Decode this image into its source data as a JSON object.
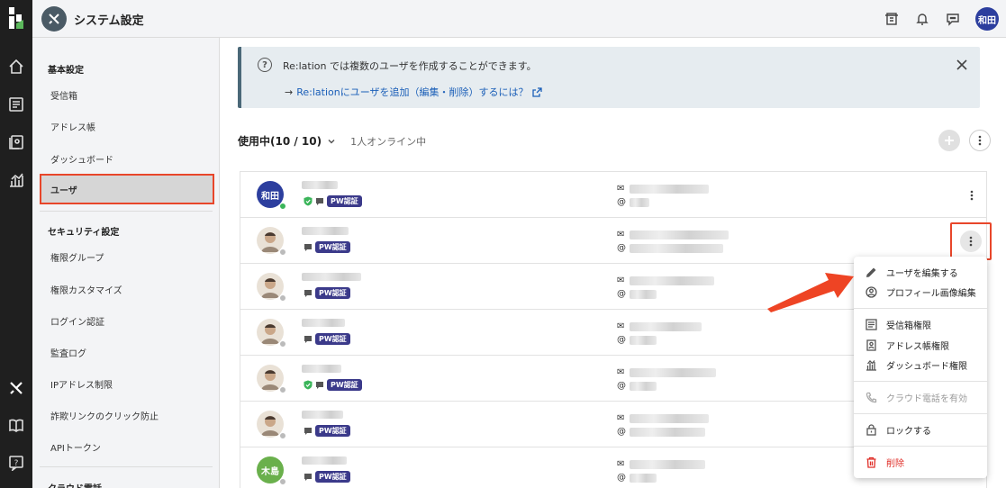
{
  "colors": {
    "accent": "#e8462a",
    "rail": "#1f1f1f",
    "link": "#1b5fb8",
    "pw_badge": "#3b3a8a",
    "danger": "#e0302a"
  },
  "header": {
    "title": "システム設定",
    "user_initials": "和田"
  },
  "sidebar": {
    "sections": [
      {
        "heading": "基本設定",
        "items": [
          "受信箱",
          "アドレス帳",
          "ダッシュボード",
          "ユーザ"
        ]
      },
      {
        "heading": "セキュリティ設定",
        "items": [
          "権限グループ",
          "権限カスタマイズ",
          "ログイン認証",
          "監査ログ",
          "IPアドレス制限",
          "詐欺リンクのクリック防止",
          "APIトークン"
        ]
      },
      {
        "heading": "クラウド電話",
        "items": []
      }
    ],
    "active_item": "ユーザ"
  },
  "banner": {
    "message": "Re:lation では複数のユーザを作成することができます。",
    "link_arrow": "→",
    "link_text": "Re:lationにユーザを追加（編集・削除）するには？"
  },
  "usage": {
    "label": "使用中(10 / 10)",
    "online": "1人オンライン中"
  },
  "users": [
    {
      "avatar_text": "和田",
      "avatar_color": "#2c3e9e",
      "online": true,
      "shield": true,
      "pw": "PW認証",
      "name_w": 40
    },
    {
      "avatar_text": "",
      "avatar_color": "#f0f0f0",
      "online": false,
      "shield": false,
      "pw": "PW認証",
      "name_w": 52
    },
    {
      "avatar_text": "",
      "avatar_color": "#f0f0f0",
      "online": false,
      "shield": false,
      "pw": "PW認証",
      "name_w": 66
    },
    {
      "avatar_text": "",
      "avatar_color": "#f0f0f0",
      "online": false,
      "shield": false,
      "pw": "PW認証",
      "name_w": 48
    },
    {
      "avatar_text": "",
      "avatar_color": "#f0f0f0",
      "online": false,
      "shield": true,
      "pw": "PW認証",
      "name_w": 44
    },
    {
      "avatar_text": "",
      "avatar_color": "#f0f0f0",
      "online": false,
      "shield": false,
      "pw": "PW認証",
      "name_w": 46
    },
    {
      "avatar_text": "木島",
      "avatar_color": "#6ab04c",
      "online": false,
      "shield": false,
      "pw": "PW認証",
      "name_w": 50
    }
  ],
  "contact_symbols": {
    "mail": "✉",
    "at": "@"
  },
  "menu": {
    "items": [
      {
        "label": "ユーザを編集する",
        "icon": "pencil-icon"
      },
      {
        "label": "プロフィール画像編集",
        "icon": "face-icon"
      },
      {
        "label": "受信箱権限",
        "icon": "inbox-icon"
      },
      {
        "label": "アドレス帳権限",
        "icon": "contact-book-icon"
      },
      {
        "label": "ダッシュボード権限",
        "icon": "dashboard-icon"
      },
      {
        "label": "クラウド電話を有効",
        "icon": "phone-icon"
      },
      {
        "label": "ロックする",
        "icon": "lock-icon"
      },
      {
        "label": "削除",
        "icon": "trash-icon"
      }
    ]
  }
}
